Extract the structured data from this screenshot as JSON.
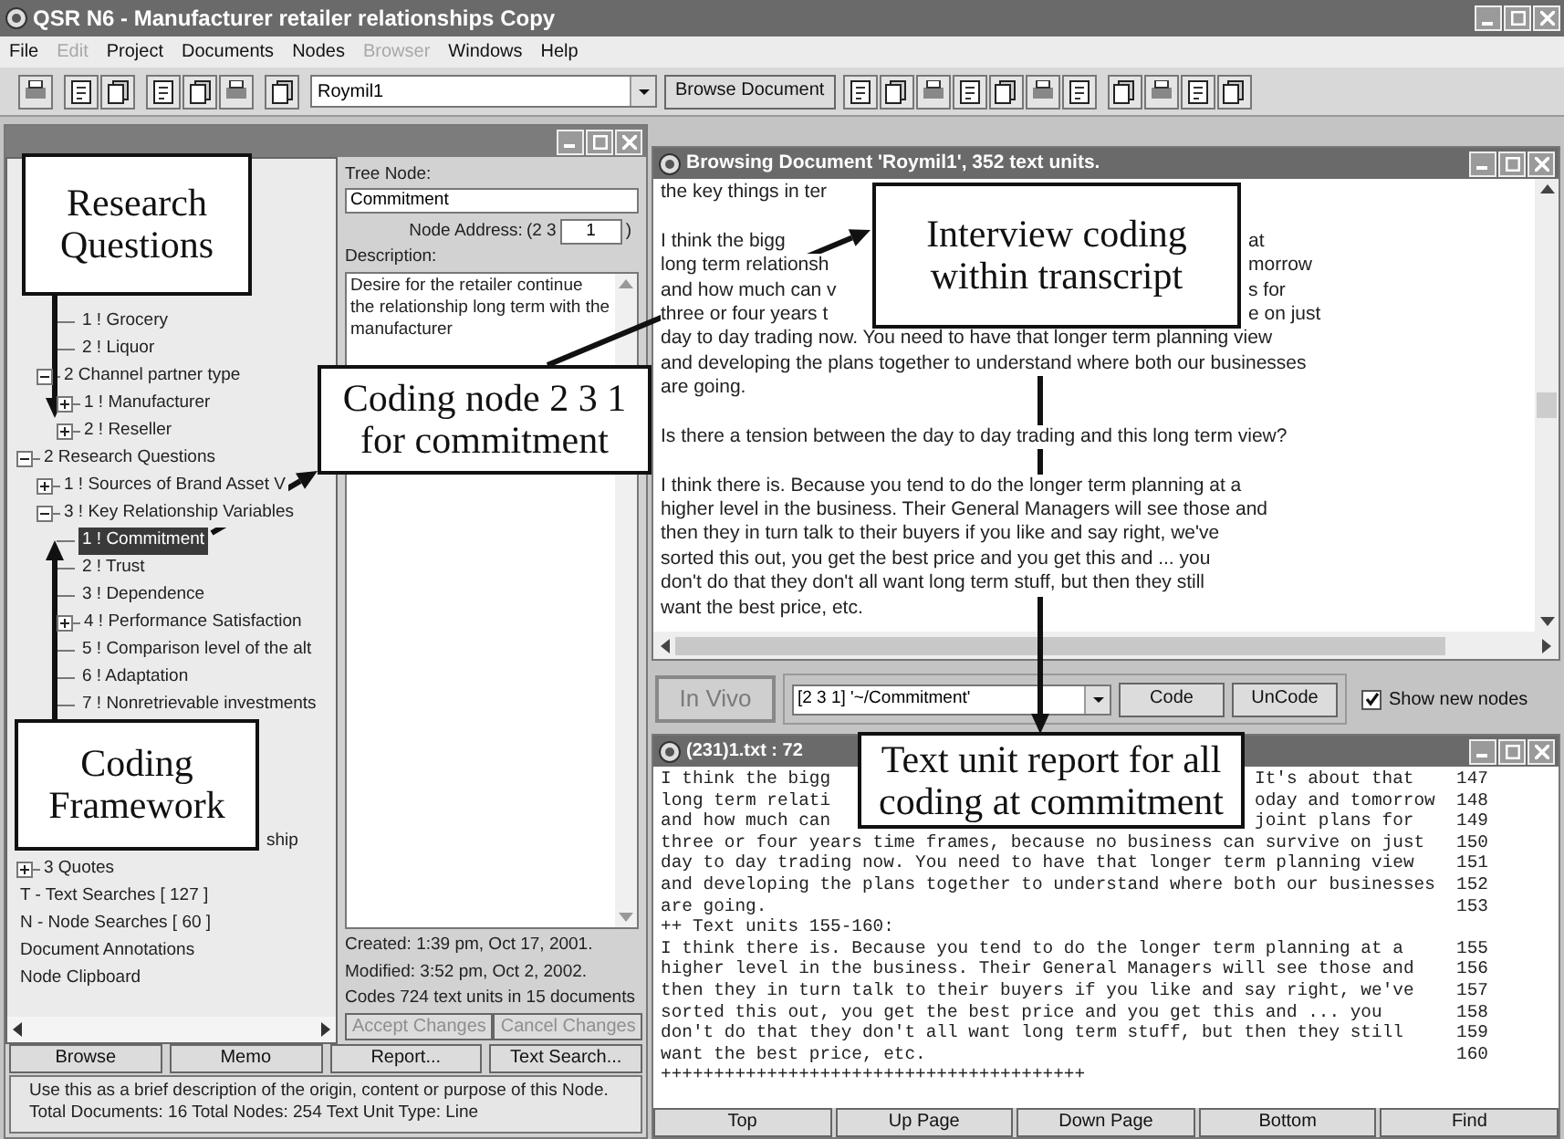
{
  "window": {
    "title": "QSR N6 - Manufacturer retailer relationships Copy"
  },
  "menu": [
    {
      "label": "File",
      "disabled": false
    },
    {
      "label": "Edit",
      "disabled": true
    },
    {
      "label": "Project",
      "disabled": false
    },
    {
      "label": "Documents",
      "disabled": false
    },
    {
      "label": "Nodes",
      "disabled": false
    },
    {
      "label": "Browser",
      "disabled": true
    },
    {
      "label": "Windows",
      "disabled": false
    },
    {
      "label": "Help",
      "disabled": false
    }
  ],
  "toolbar": {
    "document_select": "Roymil1",
    "browse_button": "Browse Document"
  },
  "node_window": {
    "tree": [
      {
        "children": [
          {
            "children": [
              {
                "label": "1 ! Grocery",
                "selected": false
              },
              {
                "label": "2 ! Liquor",
                "selected": false
              }
            ]
          },
          {
            "label": "2  Channel partner type",
            "selected": false,
            "expanded": true,
            "children": [
              {
                "label": "1 ! Manufacturer",
                "selected": false,
                "expanded": false
              },
              {
                "label": "2 ! Reseller",
                "selected": false,
                "expanded": false
              }
            ]
          }
        ]
      },
      {
        "label": "2  Research Questions",
        "selected": false,
        "expanded": true,
        "children": [
          {
            "label": "1 ! Sources of Brand Asset V",
            "selected": false,
            "expanded": false
          },
          {
            "label": "3 ! Key Relationship Variables",
            "selected": false,
            "expanded": true,
            "children": [
              {
                "label": "1 ! Commitment",
                "selected": true
              },
              {
                "label": "2 ! Trust",
                "selected": false
              },
              {
                "label": "3 ! Dependence",
                "selected": false
              },
              {
                "label": "4 ! Performance Satisfaction",
                "selected": false,
                "expanded": false
              },
              {
                "label": "5 ! Comparison level of the alt",
                "selected": false
              },
              {
                "label": "6 ! Adaptation",
                "selected": false
              },
              {
                "label": "7 ! Nonretrievable investments",
                "selected": false
              }
            ]
          },
          {
            "label": "ship",
            "kind": "cut",
            "selected": false
          }
        ]
      },
      {
        "label": "3  Quotes",
        "selected": false,
        "expanded": false
      },
      {
        "label": "T - Text Searches [ 127 ]",
        "selected": false
      },
      {
        "label": "N - Node Searches [ 60 ]",
        "selected": false
      },
      {
        "label": "Document Annotations",
        "selected": false
      },
      {
        "label": "Node Clipboard",
        "selected": false
      }
    ],
    "detail": {
      "tree_node_label": "Tree Node:",
      "tree_node": "Commitment",
      "address_label": "Node Address:",
      "address_prefix": "(2 3",
      "address_value": "1",
      "address_suffix": ")",
      "description_label": "Description:",
      "description": "Desire for the retailer continue the relationship long term with the manufacturer",
      "created": "Created:  1:39 pm, Oct 17, 2001.",
      "modified": "Modified:  3:52 pm, Oct 2, 2002.",
      "codes": "Codes 724 text units in 15 documents",
      "accept": {
        "label": "Accept Changes",
        "disabled": true
      },
      "cancel": {
        "label": "Cancel Changes",
        "disabled": true
      }
    },
    "buttons": [
      "Browse",
      "Memo",
      "Report...",
      "Text Search..."
    ],
    "status": [
      "Use this as a brief description of the origin, content or purpose of this Node.",
      "Total Documents: 16   Total Nodes: 254   Text Unit Type: Line"
    ]
  },
  "document_window": {
    "title": "Browsing Document 'Roymil1', 352 text units.",
    "lines": [
      {
        "kind": "text",
        "left": "the key things in ter"
      },
      {
        "kind": "blank"
      },
      {
        "kind": "text",
        "left": "I think the bigg",
        "right": "at"
      },
      {
        "kind": "text",
        "left": "long term relationsh",
        "right": "morrow"
      },
      {
        "kind": "text",
        "left": "and how much can v",
        "right": "s for"
      },
      {
        "kind": "text",
        "left": "three or four years t",
        "right": "e on just"
      },
      {
        "kind": "text",
        "left": "day to day trading now.  You need to have that longer term planning view"
      },
      {
        "kind": "text",
        "left": "and developing the plans together to understand where both our businesses"
      },
      {
        "kind": "text",
        "left": "are going."
      },
      {
        "kind": "blank"
      },
      {
        "kind": "text",
        "left": "Is there a tension between the day to day trading and this long term view?"
      },
      {
        "kind": "blank"
      },
      {
        "kind": "text",
        "left": "I think there is.  Because you tend to do the longer term planning at a"
      },
      {
        "kind": "text",
        "left": "higher level in the business.  Their General Managers will see those and"
      },
      {
        "kind": "text",
        "left": "then they in turn talk to their buyers if you like and say right, we've"
      },
      {
        "kind": "text",
        "left": "sorted this out, you get the best price and you get this and ... you"
      },
      {
        "kind": "text",
        "left": "don't do that they don't all want long term stuff, but then they still"
      },
      {
        "kind": "text",
        "left": "want the best price, etc."
      }
    ]
  },
  "coding_bar": {
    "in_vivo": {
      "label": "In Vivo",
      "disabled": true
    },
    "node_select": "[2 3 1] '~/Commitment'",
    "buttons": [
      "Code",
      "UnCode"
    ],
    "show_new_nodes": {
      "label": "Show new nodes",
      "checked": true
    }
  },
  "report_window": {
    "title": "(231)1.txt : 72",
    "lines": [
      {
        "left": "I think the bigg",
        "right": "It's about that",
        "unit": "147"
      },
      {
        "left": "long term relati",
        "right": "oday and tomorrow",
        "unit": "148"
      },
      {
        "left": "and how much can",
        "right": "joint plans for",
        "unit": "149"
      },
      {
        "left": "three or four years time frames, because no business can survive on just",
        "unit": "150"
      },
      {
        "left": "day to day trading now.  You need to have that longer term planning view",
        "unit": "151"
      },
      {
        "left": "and developing the plans together to understand where both our businesses",
        "unit": "152"
      },
      {
        "left": "are going.",
        "unit": "153"
      },
      {
        "left": "++ Text units 155-160:"
      },
      {
        "left": "I think there is.  Because you tend to do the longer term planning at a",
        "unit": "155"
      },
      {
        "left": "higher level in the business.  Their General Managers will see those and",
        "unit": "156"
      },
      {
        "left": "then they in turn talk to their buyers if you like and say right, we've",
        "unit": "157"
      },
      {
        "left": "sorted this out, you get the best price and you get this and ... you",
        "unit": "158"
      },
      {
        "left": "don't do that they don't all want long term stuff, but then they still",
        "unit": "159"
      },
      {
        "left": "want the best price, etc.",
        "unit": "160"
      },
      {
        "left": "++++++++++++++++++++++++++++++++++++++++"
      }
    ],
    "buttons": [
      "Top",
      "Up Page",
      "Down Page",
      "Bottom",
      "Find"
    ]
  },
  "callouts": [
    {
      "lines": [
        "Research",
        "Questions"
      ]
    },
    {
      "lines": [
        "Coding node 2 3 1",
        "for commitment"
      ]
    },
    {
      "lines": [
        "Interview coding",
        "within transcript"
      ]
    },
    {
      "lines": [
        "Coding",
        "Framework"
      ]
    },
    {
      "lines": [
        "Text unit report for all",
        "coding at commitment"
      ]
    }
  ]
}
